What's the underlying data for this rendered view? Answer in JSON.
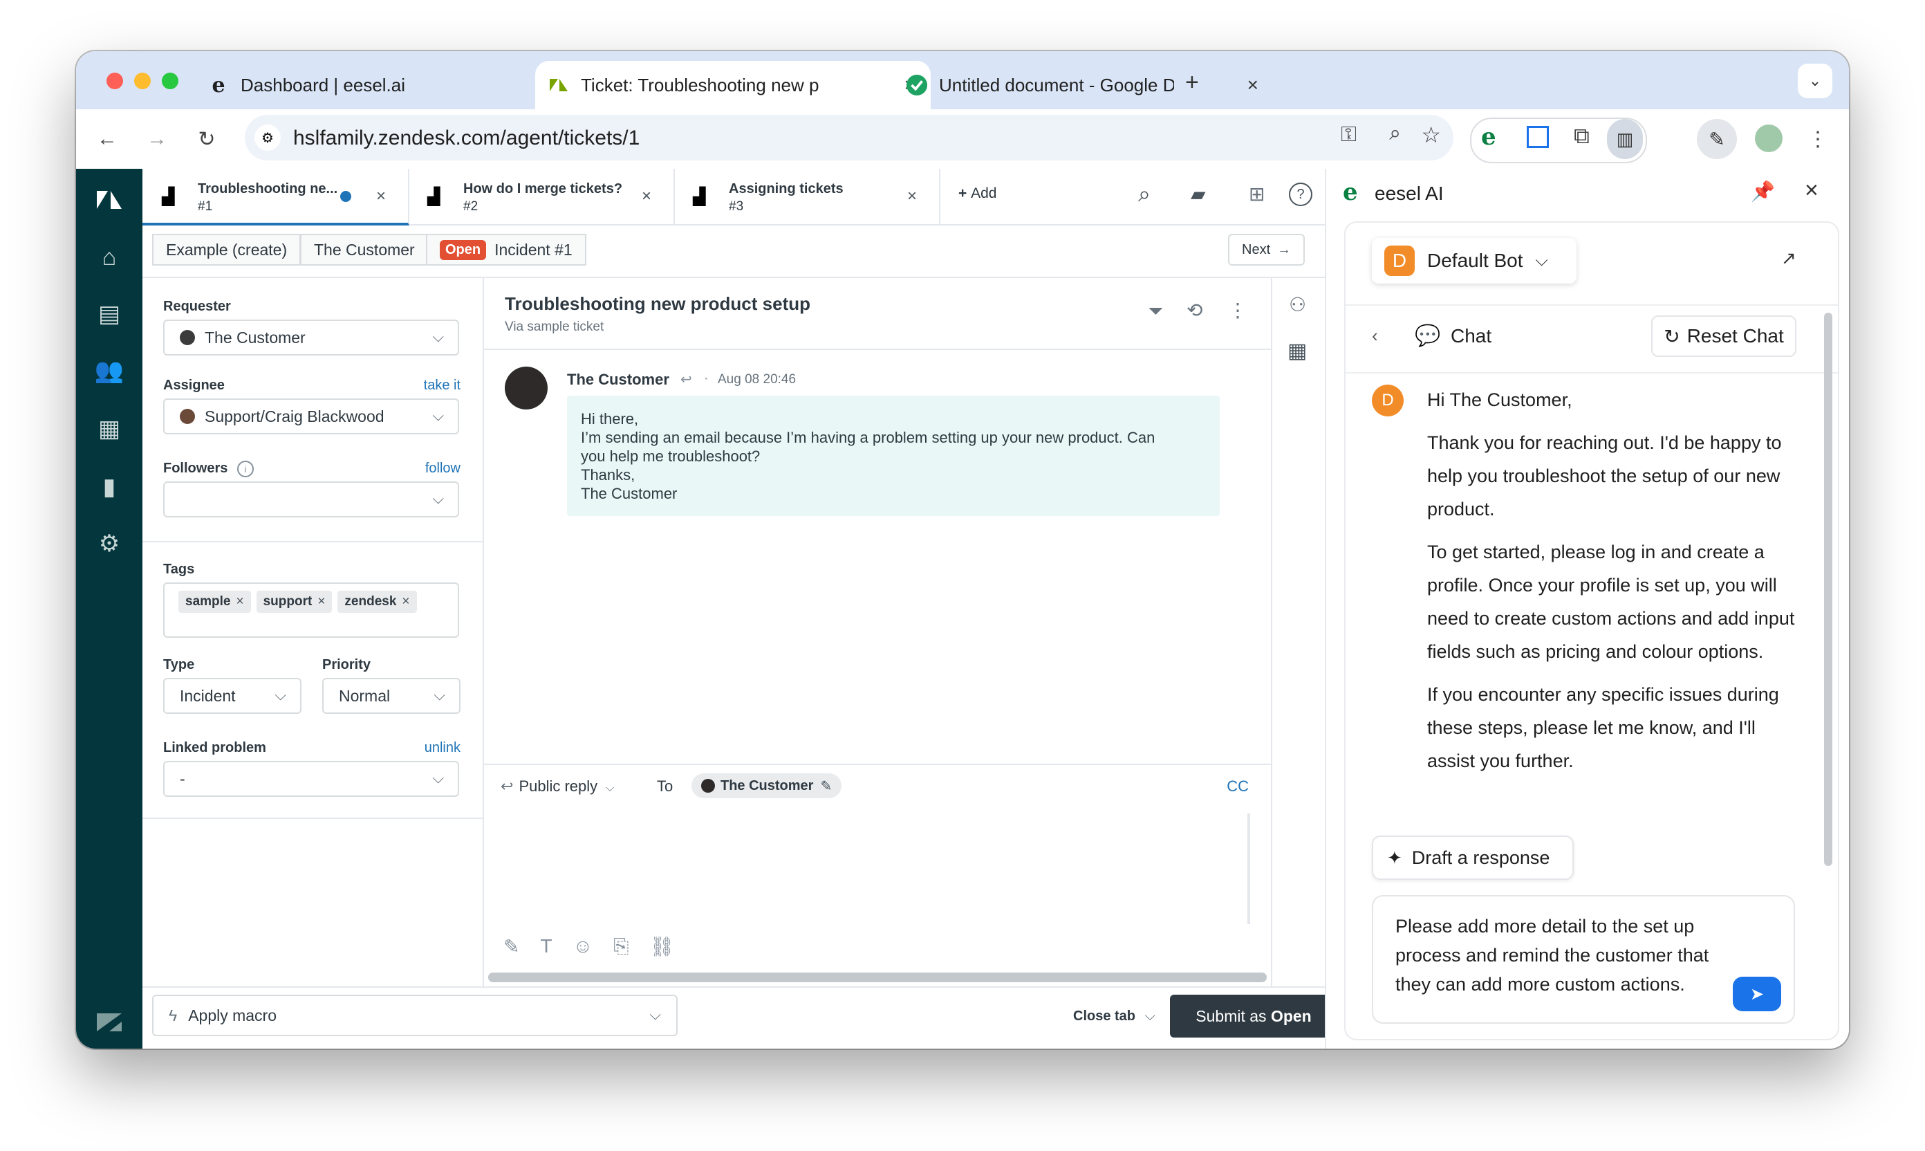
{
  "browser": {
    "tabs": [
      {
        "title": "Dashboard | eesel.ai",
        "close": "×"
      },
      {
        "title": "Ticket: Troubleshooting new p",
        "close": "×"
      },
      {
        "title": "Untitled document - Google D",
        "close": "×"
      }
    ],
    "new_tab": "+",
    "url": "hslfamily.zendesk.com/agent/tickets/1"
  },
  "zendesk": {
    "tabs": [
      {
        "title": "Troubleshooting ne...",
        "sub": "#1"
      },
      {
        "title": "How do I merge tickets?",
        "sub": "#2"
      },
      {
        "title": "Assigning tickets",
        "sub": "#3"
      }
    ],
    "add_label": "Add",
    "breadcrumbs": {
      "org": "Example (create)",
      "user": "The Customer",
      "status": "Open",
      "ticket": "Incident #1",
      "next": "Next"
    },
    "properties": {
      "requester_label": "Requester",
      "requester_value": "The Customer",
      "assignee_label": "Assignee",
      "assignee_link": "take it",
      "assignee_value": "Support/Craig Blackwood",
      "followers_label": "Followers",
      "followers_link": "follow",
      "tags_label": "Tags",
      "tags": [
        "sample",
        "support",
        "zendesk"
      ],
      "type_label": "Type",
      "type_value": "Incident",
      "priority_label": "Priority",
      "priority_value": "Normal",
      "linked_label": "Linked problem",
      "linked_link": "unlink",
      "linked_value": "-"
    },
    "ticket": {
      "title": "Troubleshooting new product setup",
      "via": "Via sample ticket",
      "author": "The Customer",
      "time": "Aug 08 20:46",
      "body_lines": [
        "Hi there,",
        "I’m sending an email because I’m having a problem setting up your new product. Can",
        "you help me troubleshoot?",
        "Thanks,",
        "The Customer"
      ]
    },
    "reply": {
      "mode": "Public reply",
      "to_label": "To",
      "to_value": "The Customer",
      "cc": "CC"
    },
    "bottom": {
      "macro": "Apply macro",
      "close_tab": "Close tab",
      "submit_prefix": "Submit as ",
      "submit_status": "Open"
    },
    "colors": {
      "nav": "#03363d",
      "submit": "#2f3941",
      "link": "#1f73b7",
      "open_badge": "#e34f32"
    }
  },
  "eesel": {
    "title": "eesel AI",
    "bot_initial": "D",
    "bot_name": "Default Bot",
    "chat_label": "Chat",
    "reset_label": "Reset Chat",
    "avatar_initial": "D",
    "message": [
      "Hi The Customer,",
      "Thank you for reaching out. I'd be happy to help you troubleshoot the setup of our new product.",
      "To get started, please log in and create a profile. Once your profile is set up, you will need to create custom actions and add input fields such as pricing and colour options.",
      "If you encounter any specific issues during these steps, please let me know, and I'll assist you further."
    ],
    "draft_label": "Draft a response",
    "input_value": "Please add more detail to the set up process and remind the customer that they can add more custom actions.",
    "colors": {
      "bot_avatar": "#f28c28",
      "send": "#1a73e8"
    }
  }
}
